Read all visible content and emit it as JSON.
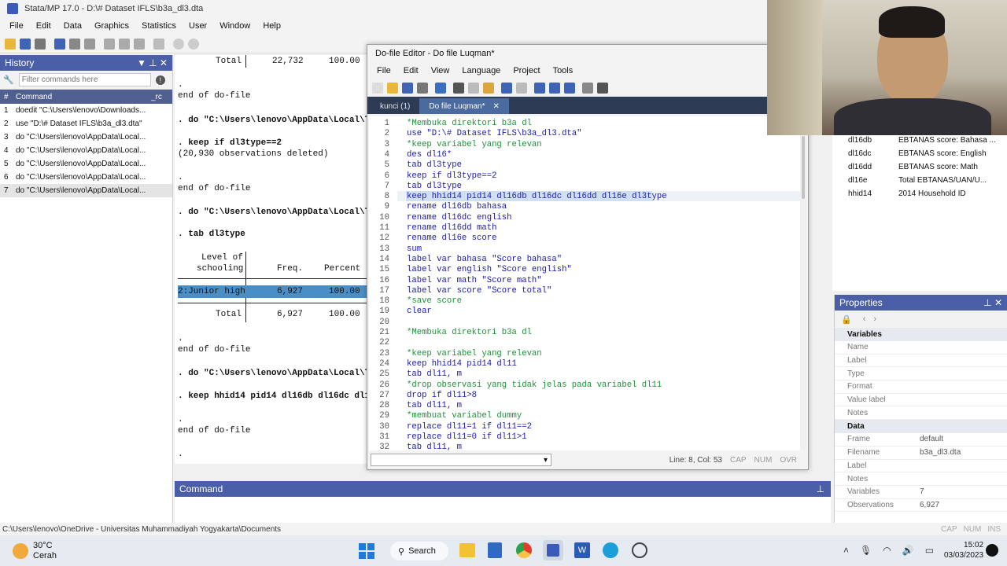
{
  "window": {
    "title": "Stata/MP 17.0 - D:\\# Dataset IFLS\\b3a_dl3.dta"
  },
  "menu": [
    "File",
    "Edit",
    "Data",
    "Graphics",
    "Statistics",
    "User",
    "Window",
    "Help"
  ],
  "history": {
    "title": "History",
    "filter_placeholder": "Filter commands here",
    "col_num": "#",
    "col_cmd": "Command",
    "col_rc": "_rc",
    "rows": [
      {
        "n": "1",
        "cmd": "doedit \"C:\\Users\\lenovo\\Downloads..."
      },
      {
        "n": "2",
        "cmd": "use \"D:\\# Dataset IFLS\\b3a_dl3.dta\""
      },
      {
        "n": "3",
        "cmd": "do \"C:\\Users\\lenovo\\AppData\\Local..."
      },
      {
        "n": "4",
        "cmd": "do \"C:\\Users\\lenovo\\AppData\\Local..."
      },
      {
        "n": "5",
        "cmd": "do \"C:\\Users\\lenovo\\AppData\\Local..."
      },
      {
        "n": "6",
        "cmd": "do \"C:\\Users\\lenovo\\AppData\\Local..."
      },
      {
        "n": "7",
        "cmd": "do \"C:\\Users\\lenovo\\AppData\\Local..."
      }
    ]
  },
  "results": {
    "total1_label": "Total",
    "total1_freq": "22,732",
    "total1_pct": "100.00",
    "dot": ".",
    "end": "end of do-file",
    "do_cmd": ". do \"C:\\Users\\lenovo\\AppData\\Local\\Temp",
    "keep_cmd": ". keep if dl3type==2",
    "deleted": "(20,930 observations deleted)",
    "tab_cmd": ". tab dl3type",
    "level_of": "Level of",
    "schooling": "schooling",
    "freq": "Freq.",
    "percent": "Percent",
    "row_label": "2:Junior high",
    "row_freq": "6,927",
    "row_pct": "100.00",
    "total2_label": "Total",
    "total2_freq": "6,927",
    "total2_pct": "100.00",
    "keep2_cmd": ". keep hhid14 pid14 dl16db dl16dc dl16dd"
  },
  "dofile": {
    "title": "Do-file Editor - Do file Luqman*",
    "menu": [
      "File",
      "Edit",
      "View",
      "Language",
      "Project",
      "Tools"
    ],
    "tabs": [
      {
        "label": "kunci (1)"
      },
      {
        "label": "Do file Luqman*"
      }
    ],
    "lines": [
      {
        "n": "1",
        "t": "*Membuka direktori b3a dl",
        "k": "cmt"
      },
      {
        "n": "2",
        "t": "use \"D:\\# Dataset IFLS\\b3a_dl3.dta\"",
        "k": "kw"
      },
      {
        "n": "3",
        "t": "*keep variabel yang relevan",
        "k": "cmt"
      },
      {
        "n": "4",
        "t": "des dl16*",
        "k": "kw"
      },
      {
        "n": "5",
        "t": "tab dl3type",
        "k": "kw"
      },
      {
        "n": "6",
        "t": "keep if dl3type==2",
        "k": "kw"
      },
      {
        "n": "7",
        "t": "tab dl3type",
        "k": "kw"
      },
      {
        "n": "8",
        "t": "keep hhid14 pid14 dl16db dl16dc dl16dd dl16e dl3type",
        "k": "sel"
      },
      {
        "n": "9",
        "t": "rename dl16db bahasa",
        "k": "kw"
      },
      {
        "n": "10",
        "t": "rename dl16dc english",
        "k": "kw"
      },
      {
        "n": "11",
        "t": "rename dl16dd math",
        "k": "kw"
      },
      {
        "n": "12",
        "t": "rename dl16e score",
        "k": "kw"
      },
      {
        "n": "13",
        "t": "sum",
        "k": "kw"
      },
      {
        "n": "14",
        "t": "label var bahasa \"Score bahasa\"",
        "k": "kw"
      },
      {
        "n": "15",
        "t": "label var english \"Score english\"",
        "k": "kw"
      },
      {
        "n": "16",
        "t": "label var math \"Score math\"",
        "k": "kw"
      },
      {
        "n": "17",
        "t": "label var score \"Score total\"",
        "k": "kw"
      },
      {
        "n": "18",
        "t": "*save score",
        "k": "cmt"
      },
      {
        "n": "19",
        "t": "clear",
        "k": "kw"
      },
      {
        "n": "20",
        "t": "",
        "k": "kw"
      },
      {
        "n": "21",
        "t": "*Membuka direktori b3a dl",
        "k": "cmt"
      },
      {
        "n": "22",
        "t": "",
        "k": "kw"
      },
      {
        "n": "23",
        "t": "*keep variabel yang relevan",
        "k": "cmt"
      },
      {
        "n": "24",
        "t": "keep hhid14 pid14 dl11",
        "k": "kw"
      },
      {
        "n": "25",
        "t": "tab dl11, m",
        "k": "kw"
      },
      {
        "n": "26",
        "t": "*drop observasi yang tidak jelas pada variabel dl11",
        "k": "cmt"
      },
      {
        "n": "27",
        "t": "drop if dl11>8",
        "k": "kw"
      },
      {
        "n": "28",
        "t": "tab dl11, m",
        "k": "kw"
      },
      {
        "n": "29",
        "t": "*membuat variabel dummy",
        "k": "cmt"
      },
      {
        "n": "30",
        "t": "replace dl11=1 if dl11==2",
        "k": "kw"
      },
      {
        "n": "31",
        "t": "replace dl11=0 if dl11>1",
        "k": "kw"
      },
      {
        "n": "32",
        "t": "tab dl11, m",
        "k": "kw"
      }
    ],
    "status": "Line: 8, Col: 53",
    "cap": "CAP",
    "num": "NUM",
    "ovr": "OVR"
  },
  "variables": [
    {
      "name": "dl16db",
      "label": "EBTANAS score: Bahasa ..."
    },
    {
      "name": "dl16dc",
      "label": "EBTANAS score: English"
    },
    {
      "name": "dl16dd",
      "label": "EBTANAS score: Math"
    },
    {
      "name": "dl16e",
      "label": "Total EBTANAS/UAN/U..."
    },
    {
      "name": "hhid14",
      "label": "2014 Household ID"
    }
  ],
  "properties": {
    "title": "Properties",
    "sec_vars": "Variables",
    "var_rows": [
      "Name",
      "Label",
      "Type",
      "Format",
      "Value label",
      "Notes"
    ],
    "sec_data": "Data",
    "data_rows": [
      {
        "k": "Frame",
        "v": "default"
      },
      {
        "k": "Filename",
        "v": "b3a_dl3.dta"
      },
      {
        "k": "Label",
        "v": ""
      },
      {
        "k": "Notes",
        "v": ""
      },
      {
        "k": "Variables",
        "v": "7"
      },
      {
        "k": "Observations",
        "v": "6,927"
      }
    ]
  },
  "command": {
    "title": "Command"
  },
  "statusbar": {
    "path": "C:\\Users\\lenovo\\OneDrive - Universitas Muhammadiyah Yogyakarta\\Documents",
    "cap": "CAP",
    "num": "NUM",
    "ins": "INS"
  },
  "taskbar": {
    "temp": "30°C",
    "weather": "Cerah",
    "search": "Search",
    "time": "15:02",
    "date": "03/03/2023"
  }
}
